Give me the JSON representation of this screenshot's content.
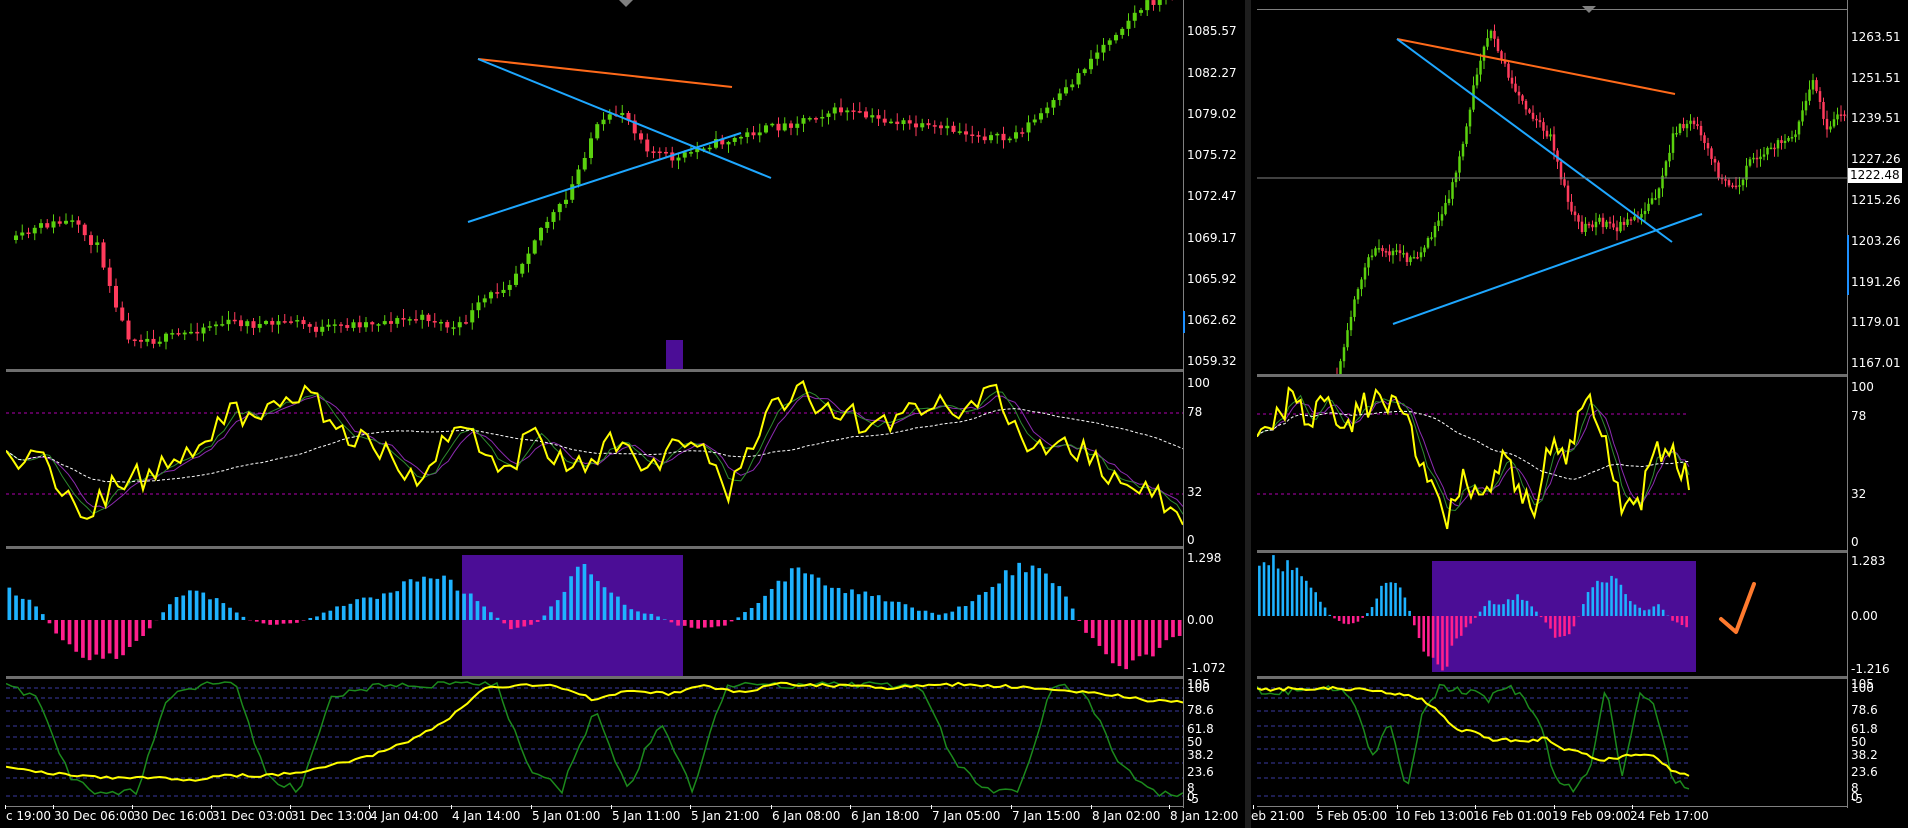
{
  "left": {
    "price_axis": [
      "1085.57",
      "1082.27",
      "1079.02",
      "1075.72",
      "1072.47",
      "1069.17",
      "1065.92",
      "1062.62",
      "1059.32"
    ],
    "stoch_axis": [
      "100",
      "78",
      "32",
      "0"
    ],
    "macd_axis": [
      "1.298",
      "0.00",
      "-1.072"
    ],
    "fib_axis": [
      "105",
      "100",
      "78.6",
      "61.8",
      "50",
      "38.2",
      "23.6",
      "8",
      "0",
      "-5"
    ],
    "time_axis": [
      "c 19:00",
      "30 Dec 06:00",
      "30 Dec 16:00",
      "31 Dec 03:00",
      "31 Dec 13:00",
      "4 Jan 04:00",
      "4 Jan 14:00",
      "5 Jan 01:00",
      "5 Jan 11:00",
      "5 Jan 21:00",
      "6 Jan 08:00",
      "6 Jan 18:00",
      "7 Jan 05:00",
      "7 Jan 15:00",
      "8 Jan 02:00",
      "8 Jan 12:00"
    ]
  },
  "right": {
    "price_axis": [
      "1263.51",
      "1251.51",
      "1239.51",
      "1227.26",
      "1215.26",
      "1203.26",
      "1191.26",
      "1179.01",
      "1167.01"
    ],
    "current_price": "1222.48",
    "stoch_axis": [
      "100",
      "78",
      "32",
      "0"
    ],
    "macd_axis": [
      "1.283",
      "0.00",
      "-1.216"
    ],
    "fib_axis": [
      "105",
      "100",
      "78.6",
      "61.8",
      "50",
      "38.2",
      "23.6",
      "8",
      "0",
      "-5"
    ],
    "time_axis": [
      "eb 21:00",
      "5 Feb 05:00",
      "10 Feb 13:00",
      "16 Feb 01:00",
      "19 Feb 09:00",
      "24 Feb 17:00"
    ]
  },
  "colors": {
    "bull": "#5ad10e",
    "bear": "#ff3b5c",
    "trend_upper": "#ff6a1a",
    "trend_lower": "#1ea7ff",
    "stoch_main": "#ffff00",
    "stoch_signal_green": "#2e8b2e",
    "stoch_signal_purple": "#8b2bb0",
    "macd_up": "#1eb2ff",
    "macd_down": "#ff1f8e",
    "highlight": "#4b0d96",
    "check": "#ff7a2e"
  },
  "icons": [
    "checkmark-icon",
    "scroll-marker-icon"
  ]
}
